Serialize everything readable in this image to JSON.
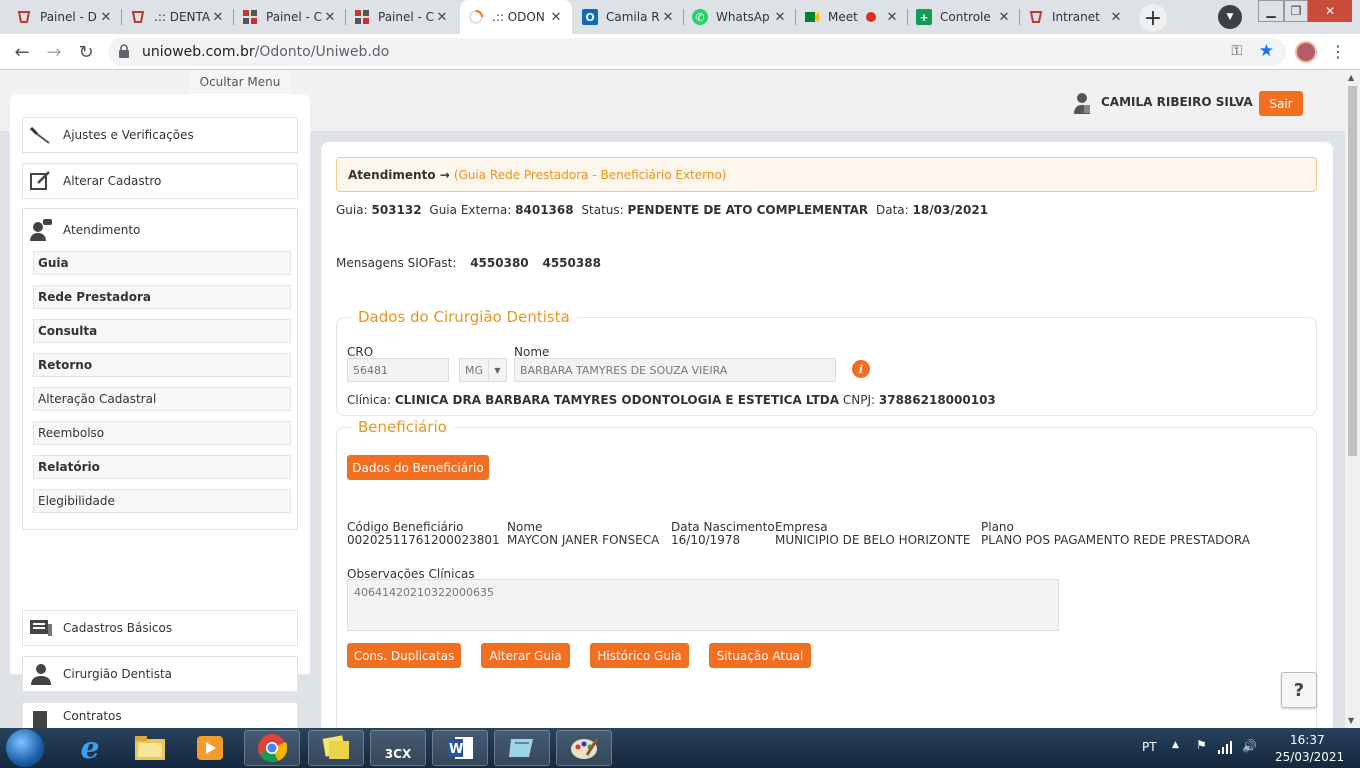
{
  "browser": {
    "tabs": [
      {
        "label": "Painel - D",
        "icon": "dental-logo-icon",
        "active": false
      },
      {
        "label": ".:: DENTA",
        "icon": "dental-logo-icon",
        "active": false
      },
      {
        "label": "Painel - C",
        "icon": "grid-icon",
        "active": false
      },
      {
        "label": "Painel - C",
        "icon": "grid-icon",
        "active": false
      },
      {
        "label": ".:: ODON",
        "icon": "loading-icon",
        "active": true
      },
      {
        "label": "Camila R",
        "icon": "outlook-icon",
        "active": false
      },
      {
        "label": "WhatsAp",
        "icon": "whatsapp-icon",
        "active": false
      },
      {
        "label": "Meet",
        "icon": "meet-icon",
        "active": false
      },
      {
        "label": "Controle",
        "icon": "sheets-icon",
        "active": false
      },
      {
        "label": "Intranet",
        "icon": "dental-logo-icon",
        "active": false
      }
    ],
    "url_domain": "unioweb.com.br",
    "url_path": "/Odonto/Uniweb.do"
  },
  "header": {
    "user_name": "CAMILA RIBEIRO SILVA",
    "logout_label": "Sair"
  },
  "sidebar": {
    "hide_label": "Ocultar Menu",
    "items_top": [
      {
        "label": "Ajustes e Verificações",
        "icon": "screwdriver-icon"
      },
      {
        "label": "Alterar Cadastro",
        "icon": "edit-icon"
      }
    ],
    "group": {
      "label": "Atendimento",
      "icon": "user-chat-icon",
      "subitems": [
        {
          "label": "Guia",
          "bold": true
        },
        {
          "label": "Rede Prestadora",
          "bold": true
        },
        {
          "label": "Consulta",
          "bold": true
        },
        {
          "label": "Retorno",
          "bold": true
        },
        {
          "label": "Alteração Cadastral",
          "bold": false
        },
        {
          "label": "Reembolso",
          "bold": false
        },
        {
          "label": "Relatório",
          "bold": true
        },
        {
          "label": "Elegibilidade",
          "bold": false
        }
      ]
    },
    "items_bottom": [
      {
        "label": "Cadastros Básicos",
        "icon": "cards-icon"
      },
      {
        "label": "Cirurgião Dentista",
        "icon": "person-icon"
      },
      {
        "label": "Contratos",
        "icon": "document-icon"
      }
    ]
  },
  "main": {
    "breadcrumb_title": "Atendimento →",
    "breadcrumb_sub": "(Guia Rede Prestadora - Beneficiário Externo)",
    "guia_label": "Guia:",
    "guia_value": "503132",
    "guia_externa_label": "Guia Externa:",
    "guia_externa_value": "8401368",
    "status_label": "Status:",
    "status_value": "PENDENTE DE ATO COMPLEMENTAR",
    "data_label": "Data:",
    "data_value": "18/03/2021",
    "mensagens_label": "Mensagens SIOFast:",
    "mensagens_values": [
      "4550380",
      "4550388"
    ],
    "dentista": {
      "legend": "Dados do Cirurgião Dentista",
      "cro_label": "CRO",
      "cro_value": "56481",
      "uf_value": "MG",
      "nome_label": "Nome",
      "nome_value": "BARBARA TAMYRES DE SOUZA VIEIRA",
      "info_symbol": "i",
      "clinica_label": "Clínica:",
      "clinica_value": "CLINICA DRA BARBARA TAMYRES ODONTOLOGIA E ESTETICA LTDA",
      "cnpj_label": "CNPJ:",
      "cnpj_value": "37886218000103"
    },
    "beneficiario": {
      "legend": "Beneficiário",
      "dados_button": "Dados do Beneficiário",
      "codigo_label": "Código Beneficiário",
      "codigo_value": "00202511761200023801",
      "nome_label": "Nome",
      "nome_value": "MAYCON JANER FONSECA",
      "nascimento_label": "Data Nascimento",
      "nascimento_value": "16/10/1978",
      "empresa_label": "Empresa",
      "empresa_value": "MUNICIPIO DE BELO HORIZONTE",
      "plano_label": "Plano",
      "plano_value": "PLANO POS PAGAMENTO REDE PRESTADORA",
      "obs_label": "Observações Clínicas",
      "obs_value": "40641420210322000635",
      "buttons": [
        "Cons. Duplicatas",
        "Alterar Guia",
        "Histórico Guia",
        "Situação Atual"
      ]
    },
    "help_label": "?"
  },
  "taskbar": {
    "language": "PT",
    "time": "16:37",
    "date": "25/03/2021",
    "threecx_label": "3CX"
  }
}
